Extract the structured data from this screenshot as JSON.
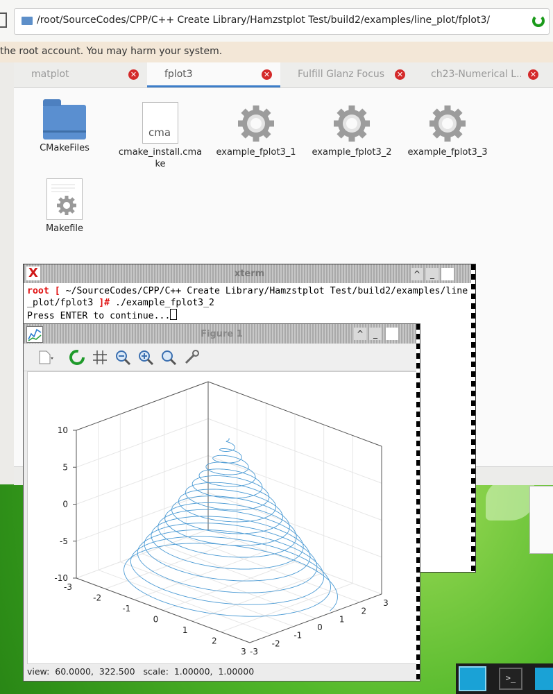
{
  "file_manager": {
    "path": "/root/SourceCodes/CPP/C++ Create Library/Hamzstplot Test/build2/examples/line_plot/fplot3/",
    "warning": "the root account. You may harm your system.",
    "tabs": [
      {
        "label": "matplot",
        "active": false
      },
      {
        "label": "fplot3",
        "active": true
      },
      {
        "label": "Fulfill Glanz Focus",
        "active": false
      },
      {
        "label": "ch23-Numerical L...",
        "active": false
      }
    ],
    "files": [
      {
        "label": "CMakeFiles",
        "icon": "folder-icon"
      },
      {
        "label": "cmake_install.cma\nke",
        "icon": "cmake-document-icon",
        "thumb": "cma"
      },
      {
        "label": "example_fplot3_1",
        "icon": "executable-gear-icon"
      },
      {
        "label": "example_fplot3_2",
        "icon": "executable-gear-icon"
      },
      {
        "label": "example_fplot3_3",
        "icon": "executable-gear-icon"
      },
      {
        "label": "Makefile",
        "icon": "makefile-icon"
      }
    ]
  },
  "xterm": {
    "title": "xterm",
    "line1_prompt": "root [ ",
    "line1_path": "~/SourceCodes/CPP/C++ Create Library/Hamzstplot Test/build2/examples/line",
    "line2_path": "_plot/fplot3 ",
    "line2_prompt": "]# ",
    "line2_cmd": "./example_fplot3_2",
    "line3": "Press ENTER to continue...",
    "minimize": "_",
    "maximize": "^"
  },
  "figure": {
    "title": "Figure 1",
    "status": "view:  60.0000,  322.500   scale:  1.00000,  1.00000",
    "minimize": "_",
    "maximize": "^",
    "toolbar": [
      "new-document-icon",
      "reload-icon",
      "grid-icon",
      "zoom-out-icon",
      "zoom-in-icon",
      "zoom-fit-icon",
      "wrench-icon"
    ]
  },
  "chart_data": {
    "type": "line",
    "title": "",
    "xlabel": "",
    "ylabel": "",
    "zlabel": "",
    "xlim": [
      -3,
      3
    ],
    "ylim": [
      -3,
      3
    ],
    "zlim": [
      -10,
      10
    ],
    "view": [
      60,
      322.5
    ],
    "x_ticks": [
      "-3",
      "-2",
      "-1",
      "0",
      "1",
      "2",
      "3"
    ],
    "y_ticks": [
      "-3",
      "-2",
      "-1",
      "0",
      "1",
      "2",
      "3"
    ],
    "z_ticks": [
      "-10",
      "-5",
      "0",
      "5",
      "10"
    ],
    "grid": true,
    "series": [
      {
        "color": "#4a9ad4",
        "parametric": "x = (1 - z/10)·1.5·cos(t·5), y = (1 - z/10)·1.5·sin(t·5), z = t",
        "t_range": [
          -10,
          10
        ]
      }
    ]
  },
  "taskbar": {
    "terminal_glyph": ">_"
  }
}
